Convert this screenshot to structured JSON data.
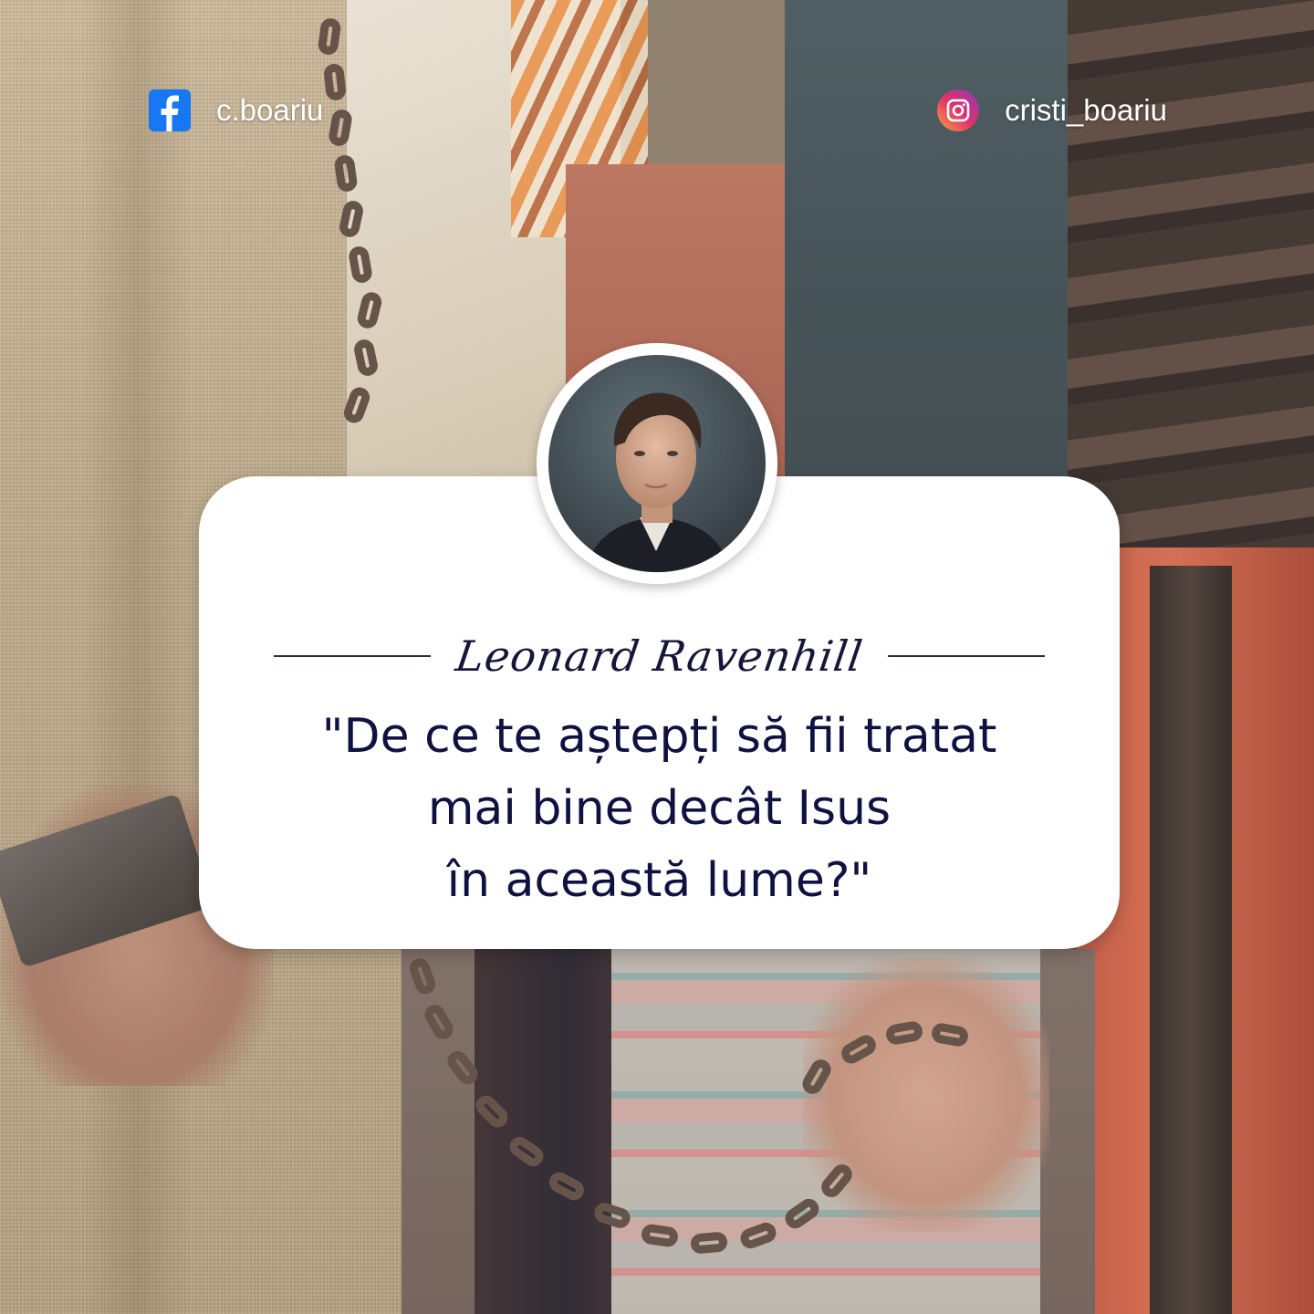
{
  "social": {
    "facebook": {
      "icon": "facebook-icon",
      "handle": "c.boariu",
      "color": "#1877f2"
    },
    "instagram": {
      "icon": "instagram-icon",
      "handle": "cristi_boariu"
    }
  },
  "card": {
    "author": "Leonard Ravenhill",
    "quote_lines": [
      "\"De ce te aștepți să fii tratat",
      "mai bine decât Isus",
      "în această lume?\""
    ],
    "text_color": "#0f1240"
  }
}
